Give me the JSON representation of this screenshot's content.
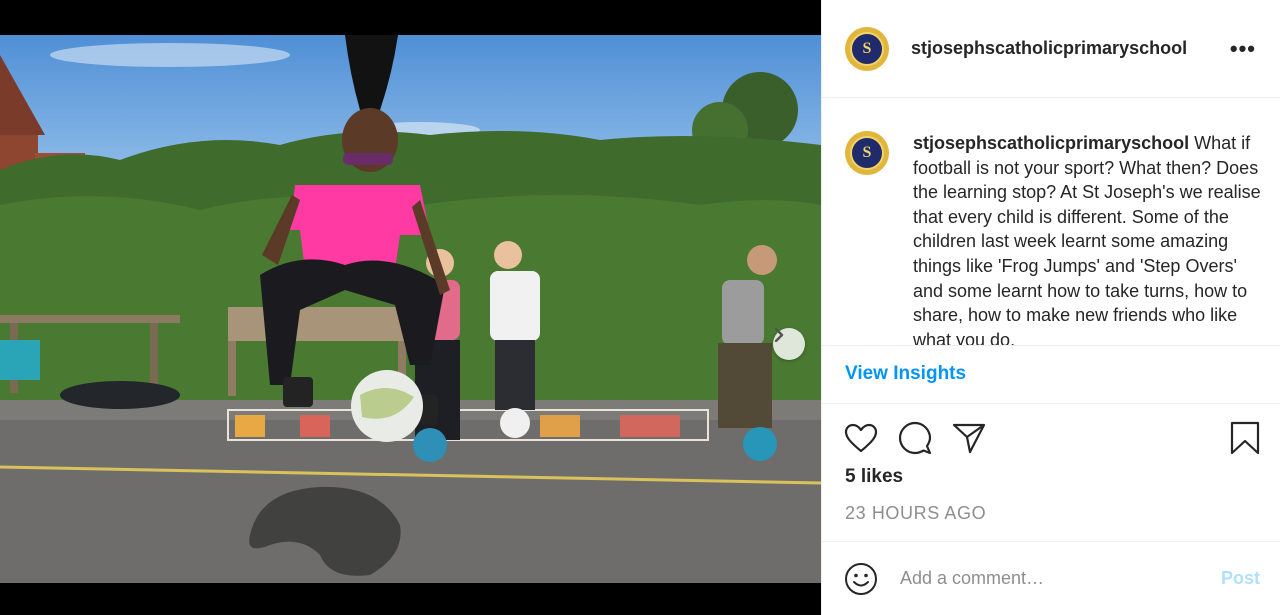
{
  "post": {
    "username": "stjosephscatholicprimaryschool",
    "more_label": "•••",
    "avatar_letter": "S",
    "caption": "What if football is not your sport? What then? Does the learning stop? At St Joseph's we realise that every child is different. Some of the children last week learnt some amazing things like 'Frog Jumps' and 'Step Overs' and some learnt how to take turns, how to share, how to make new friends who like what you do.",
    "insights_label": "View Insights",
    "likes": "5 likes",
    "time": "23 HOURS AGO",
    "comment_placeholder": "Add a comment…",
    "post_label": "Post"
  },
  "carousel": {
    "slide_count": 10,
    "active_index": 0
  },
  "colors": {
    "link": "#0095f6",
    "post_disabled": "#b2dffc",
    "text": "#262626",
    "muted": "#8e8e8e"
  },
  "icons": [
    "chevron-right-icon",
    "heart-icon",
    "comment-icon",
    "share-icon",
    "bookmark-icon",
    "emoji-icon"
  ]
}
